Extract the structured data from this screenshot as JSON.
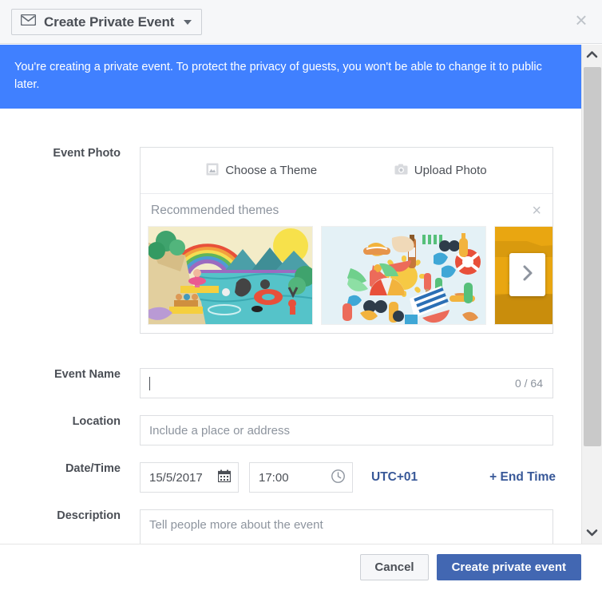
{
  "header": {
    "button_label": "Create Private Event",
    "mail_icon": "envelope-icon",
    "caret_icon": "caret-down-icon",
    "close_icon": "×"
  },
  "notice": {
    "text": "You're creating a private event. To protect the privacy of guests, you won't be able to change it to public later.",
    "background": "#4080ff",
    "color": "#ffffff"
  },
  "form": {
    "photo": {
      "label": "Event Photo",
      "choose_theme": "Choose a Theme",
      "choose_theme_icon": "image-frame-icon",
      "upload_photo": "Upload Photo",
      "upload_photo_icon": "camera-icon",
      "themes_title": "Recommended themes",
      "themes_close_icon": "×",
      "next_icon": "chevron-right-icon",
      "themes": [
        {
          "name": "lake-swimming-rainbow"
        },
        {
          "name": "summer-items-sun"
        },
        {
          "name": "desert-cactus"
        }
      ]
    },
    "event_name": {
      "label": "Event Name",
      "value": "",
      "placeholder": "",
      "char_count": "0 / 64"
    },
    "location": {
      "label": "Location",
      "value": "",
      "placeholder": "Include a place or address"
    },
    "datetime": {
      "label": "Date/Time",
      "date_value": "15/5/2017",
      "date_icon": "calendar-icon",
      "time_value": "17:00",
      "time_icon": "clock-icon",
      "timezone": "UTC+01",
      "end_time_link": "+ End Time"
    },
    "description": {
      "label": "Description",
      "value": "",
      "placeholder": "Tell people more about the event"
    }
  },
  "scrollbar": {
    "up_icon": "chevron-up-icon",
    "down_icon": "chevron-down-icon"
  },
  "footer": {
    "cancel_label": "Cancel",
    "submit_label": "Create private event",
    "submit_color": "#4267b2"
  }
}
